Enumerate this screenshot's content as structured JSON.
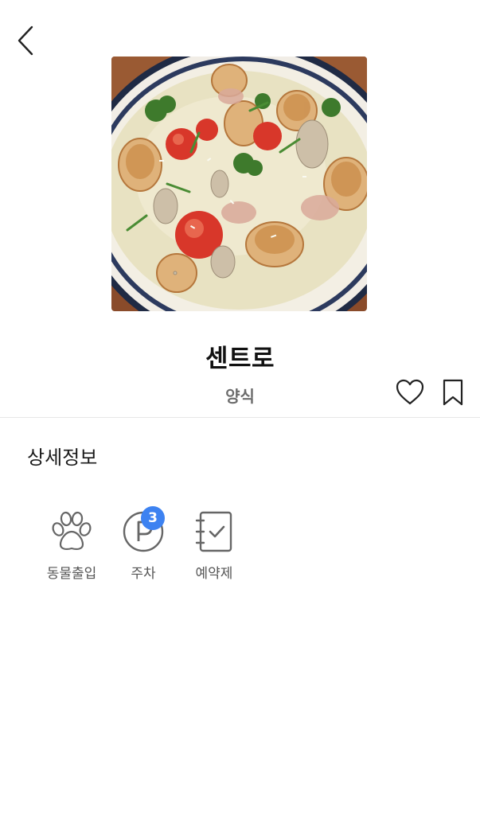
{
  "header": {
    "back_icon": "chevron-left-icon"
  },
  "restaurant": {
    "name": "센트로",
    "category": "양식",
    "photo_icon": "food-photo"
  },
  "actions": {
    "like_icon": "heart-icon",
    "bookmark_icon": "bookmark-icon"
  },
  "details": {
    "title": "상세정보",
    "features": [
      {
        "label": "동물출입",
        "icon": "paw-icon"
      },
      {
        "label": "주차",
        "icon": "parking-icon",
        "badge": "3"
      },
      {
        "label": "예약제",
        "icon": "reservation-icon"
      }
    ]
  },
  "colors": {
    "badge": "#3d82f1",
    "icon_stroke": "#666666",
    "divider": "#e6e6e6"
  }
}
